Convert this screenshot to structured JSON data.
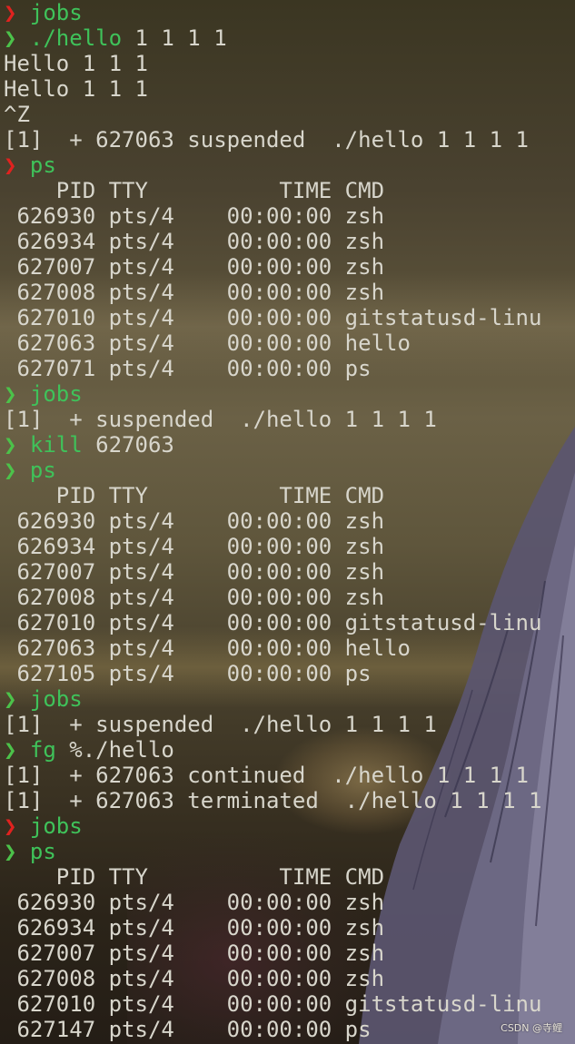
{
  "terminal": {
    "lines": [
      {
        "kind": "prompt",
        "arrow": "❯",
        "arrow_color": "red",
        "cmd": "jobs",
        "args": ""
      },
      {
        "kind": "prompt",
        "arrow": "❯",
        "arrow_color": "green",
        "cmd": "./hello",
        "args": " 1 1 1 1"
      },
      {
        "kind": "out",
        "text": "Hello 1 1 1"
      },
      {
        "kind": "out",
        "text": "Hello 1 1 1"
      },
      {
        "kind": "out",
        "text": "^Z"
      },
      {
        "kind": "out",
        "text": "[1]  + 627063 suspended  ./hello 1 1 1 1"
      },
      {
        "kind": "prompt",
        "arrow": "❯",
        "arrow_color": "red",
        "cmd": "ps",
        "args": ""
      },
      {
        "kind": "out",
        "text": "    PID TTY          TIME CMD"
      },
      {
        "kind": "out",
        "text": " 626930 pts/4    00:00:00 zsh"
      },
      {
        "kind": "out",
        "text": " 626934 pts/4    00:00:00 zsh"
      },
      {
        "kind": "out",
        "text": " 627007 pts/4    00:00:00 zsh"
      },
      {
        "kind": "out",
        "text": " 627008 pts/4    00:00:00 zsh"
      },
      {
        "kind": "out",
        "text": " 627010 pts/4    00:00:00 gitstatusd-linu"
      },
      {
        "kind": "out",
        "text": " 627063 pts/4    00:00:00 hello"
      },
      {
        "kind": "out",
        "text": " 627071 pts/4    00:00:00 ps"
      },
      {
        "kind": "prompt",
        "arrow": "❯",
        "arrow_color": "green",
        "cmd": "jobs",
        "args": ""
      },
      {
        "kind": "out",
        "text": "[1]  + suspended  ./hello 1 1 1 1"
      },
      {
        "kind": "prompt",
        "arrow": "❯",
        "arrow_color": "green",
        "cmd": "kill",
        "args": " 627063"
      },
      {
        "kind": "prompt",
        "arrow": "❯",
        "arrow_color": "green",
        "cmd": "ps",
        "args": ""
      },
      {
        "kind": "out",
        "text": "    PID TTY          TIME CMD"
      },
      {
        "kind": "out",
        "text": " 626930 pts/4    00:00:00 zsh"
      },
      {
        "kind": "out",
        "text": " 626934 pts/4    00:00:00 zsh"
      },
      {
        "kind": "out",
        "text": " 627007 pts/4    00:00:00 zsh"
      },
      {
        "kind": "out",
        "text": " 627008 pts/4    00:00:00 zsh"
      },
      {
        "kind": "out",
        "text": " 627010 pts/4    00:00:00 gitstatusd-linu"
      },
      {
        "kind": "out",
        "text": " 627063 pts/4    00:00:00 hello"
      },
      {
        "kind": "out",
        "text": " 627105 pts/4    00:00:00 ps"
      },
      {
        "kind": "prompt",
        "arrow": "❯",
        "arrow_color": "green",
        "cmd": "jobs",
        "args": ""
      },
      {
        "kind": "out",
        "text": "[1]  + suspended  ./hello 1 1 1 1"
      },
      {
        "kind": "prompt",
        "arrow": "❯",
        "arrow_color": "green",
        "cmd": "fg",
        "args": " %./hello"
      },
      {
        "kind": "out",
        "text": "[1]  + 627063 continued  ./hello 1 1 1 1"
      },
      {
        "kind": "out",
        "text": "[1]  + 627063 terminated  ./hello 1 1 1 1"
      },
      {
        "kind": "prompt",
        "arrow": "❯",
        "arrow_color": "red",
        "cmd": "jobs",
        "args": ""
      },
      {
        "kind": "prompt",
        "arrow": "❯",
        "arrow_color": "green",
        "cmd": "ps",
        "args": ""
      },
      {
        "kind": "out",
        "text": "    PID TTY          TIME CMD"
      },
      {
        "kind": "out",
        "text": " 626930 pts/4    00:00:00 zsh"
      },
      {
        "kind": "out",
        "text": " 626934 pts/4    00:00:00 zsh"
      },
      {
        "kind": "out",
        "text": " 627007 pts/4    00:00:00 zsh"
      },
      {
        "kind": "out",
        "text": " 627008 pts/4    00:00:00 zsh"
      },
      {
        "kind": "out",
        "text": " 627010 pts/4    00:00:00 gitstatusd-linu"
      },
      {
        "kind": "out",
        "text": " 627147 pts/4    00:00:00 ps"
      }
    ]
  },
  "colors": {
    "arrow_red": "#e0221f",
    "arrow_green": "#4cc24a",
    "command": "#3fc25a",
    "output": "#d8d6cc"
  },
  "watermark": "CSDN @寺鲤"
}
